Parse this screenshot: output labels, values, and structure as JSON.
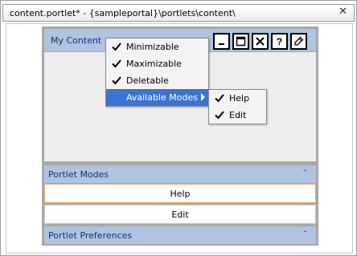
{
  "editor": {
    "tab_title": "content.portlet* - {sampleportal}\\portlets\\content\\",
    "close_glyph": "✕"
  },
  "portlet": {
    "title": "My Content",
    "buttons": [
      {
        "name": "minimize",
        "icon": "minimize-icon"
      },
      {
        "name": "maximize",
        "icon": "maximize-icon"
      },
      {
        "name": "close",
        "icon": "close-icon"
      },
      {
        "name": "help",
        "icon": "help-icon"
      },
      {
        "name": "edit",
        "icon": "pencil-icon"
      }
    ],
    "modes_header": "Portlet Modes",
    "modes": [
      "Help",
      "Edit"
    ],
    "preferences_header": "Portlet Preferences",
    "collapse_glyph": "⌃"
  },
  "context_menu": {
    "items": [
      {
        "label": "Minimizable",
        "checked": true
      },
      {
        "label": "Maximizable",
        "checked": true
      },
      {
        "label": "Deletable",
        "checked": true
      },
      {
        "label": "Available Modes",
        "checked": false,
        "submenu": true,
        "active": true
      }
    ]
  },
  "submenu": {
    "items": [
      {
        "label": "Help",
        "checked": true
      },
      {
        "label": "Edit",
        "checked": true
      }
    ]
  },
  "colors": {
    "header_bg": "#aec4e0",
    "header_text": "#17307a",
    "menu_highlight": "#3d73d1",
    "selected_border": "#f0a460"
  }
}
